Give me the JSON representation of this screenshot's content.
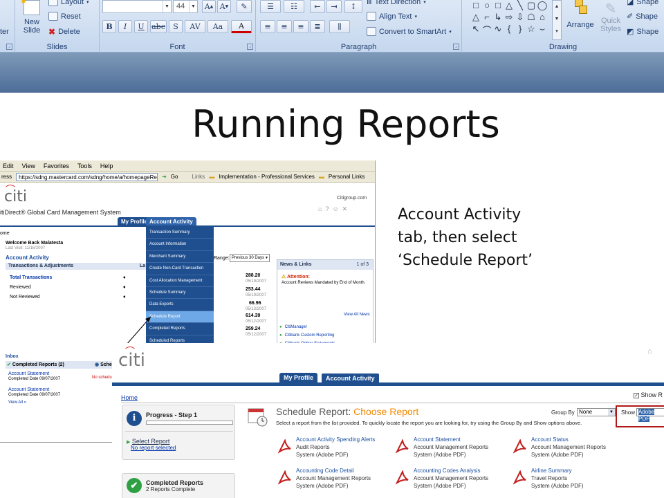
{
  "ribbon": {
    "slides_group": {
      "label": "Slides",
      "new_slide_label": "New\nSlide",
      "layout_label": "Layout",
      "reset_label": "Reset",
      "delete_label": "Delete",
      "partial_left_label": "ter"
    },
    "font_group": {
      "label": "Font",
      "font_size_value": "44",
      "buttons": [
        "B",
        "I",
        "U",
        "abc",
        "S",
        "AV",
        "Aa",
        "A"
      ]
    },
    "paragraph_group": {
      "label": "Paragraph",
      "text_direction_label": "Text Direction",
      "align_text_label": "Align Text",
      "convert_smartart_label": "Convert to SmartArt"
    },
    "drawing_group": {
      "label": "Drawing",
      "arrange_label": "Arrange",
      "quick_styles_label": "Quick\nStyles",
      "shape_fill_label": "Shape",
      "shape_outline_label": "Shape",
      "shape_effects_label": "Shape"
    }
  },
  "slide": {
    "title": "Running Reports",
    "caption_lines": [
      "Account Activity",
      "tab, then select",
      "‘Schedule Report’"
    ]
  },
  "screenshot1": {
    "menu": [
      "Edit",
      "View",
      "Favorites",
      "Tools",
      "Help"
    ],
    "address_label": "ress",
    "url": "https://sdng.mastercard.com/sdng/home/a/homepageRender.d",
    "go_label": "Go",
    "links_label": "Links",
    "link_items": [
      "Implementation - Professional Services",
      "Personal Links"
    ],
    "logo_text": "citi",
    "system_name": "itiDirect® Global Card Management System",
    "citigroup_label": "Citigroup.com",
    "tabs": [
      "My Profile",
      "Account Activity"
    ],
    "home_label": "ome",
    "welcome": "Welcome Back Malatesta",
    "last_visit": "Last Visit: 11/16/2007",
    "account_activity_heading": "Account Activity",
    "transactions_label": "Transactions & Adjustments",
    "rows": [
      "Total Transactions",
      "Reviewed",
      "Not Reviewed"
    ],
    "range_label": "Range:",
    "range_value": "Previous 30 Days",
    "amounts": [
      {
        "value": "288.20",
        "date": "05/19/2007"
      },
      {
        "value": "253.44",
        "date": "05/19/2007"
      },
      {
        "value": "66.96",
        "date": "05/13/2007"
      },
      {
        "value": "614.39",
        "date": "05/12/2007"
      },
      {
        "value": "259.24",
        "date": "05/12/2007"
      }
    ],
    "dropdown_items": [
      "Transaction Summary",
      "Account Information",
      "Merchant Summary",
      "Create Non-Card Transaction",
      "Cost Allocation Management",
      "Schedule Summary",
      "Data Exports",
      "Schedule Report",
      "Completed Reports",
      "Scheduled Reports"
    ],
    "news_heading": "News & Links",
    "news_pager": "1 of 3",
    "attention_label": "Attention:",
    "attention_text": "Account Reviews Mandated by End of Month.",
    "view_all_news": "View All News",
    "news_links": [
      "CitiManager",
      "Citibank Custom Reporting",
      "Citibank Online Statements"
    ],
    "inbox_label": "Inbox",
    "completed_reports_tab": "Completed Reports (2)",
    "sche_tab": "Sche",
    "no_schedule": "No schedu",
    "inbox_items": [
      {
        "title": "Account Statement",
        "date": "Completed Date  09/07/2007"
      },
      {
        "title": "Account Statement",
        "date": "Completed Date  09/07/2007"
      }
    ],
    "view_all": "View All »"
  },
  "screenshot2": {
    "logo_text": "citi",
    "tabs": [
      "My Profile",
      "Account Activity"
    ],
    "home_link": "Home",
    "show_label_top": "Show R",
    "progress_title": "Progress - Step 1",
    "select_report_link": "Select Report",
    "no_report_selected": "No report selected",
    "completed_reports_title": "Completed Reports",
    "completed_reports_count": "2 Reports Complete",
    "page_title": "Schedule Report:",
    "page_title_highlight": "Choose Report",
    "instructions": "Select a report from the list provided. To quickly locate the report you are looking for, try using the Group By and Show options above.",
    "group_by_label": "Group By",
    "group_by_value": "None",
    "show_label": "Show",
    "show_value": "Adobe PDF",
    "reports": [
      {
        "title": "Account Activity Spending Alerts",
        "category": "Audit Reports",
        "format": "System (Adobe PDF)"
      },
      {
        "title": "Account Statement",
        "category": "Account Management Reports",
        "format": "System (Adobe PDF)"
      },
      {
        "title": "Account Status",
        "category": "Account Management Reports",
        "format": "System (Adobe PDF)"
      },
      {
        "title": "Accounting Code Detail",
        "category": "Account Management Reports",
        "format": "System (Adobe PDF)"
      },
      {
        "title": "Accounting Codes Analysis",
        "category": "Account Management Reports",
        "format": "System (Adobe PDF)"
      },
      {
        "title": "Airline Summary",
        "category": "Travel Reports",
        "format": "System (Adobe PDF)"
      }
    ]
  },
  "colors": {
    "citi_blue": "#1f4f8f",
    "citi_red": "#dd2222",
    "schedule_orange": "#f08a00",
    "highlight_red_box": "#b01818"
  }
}
